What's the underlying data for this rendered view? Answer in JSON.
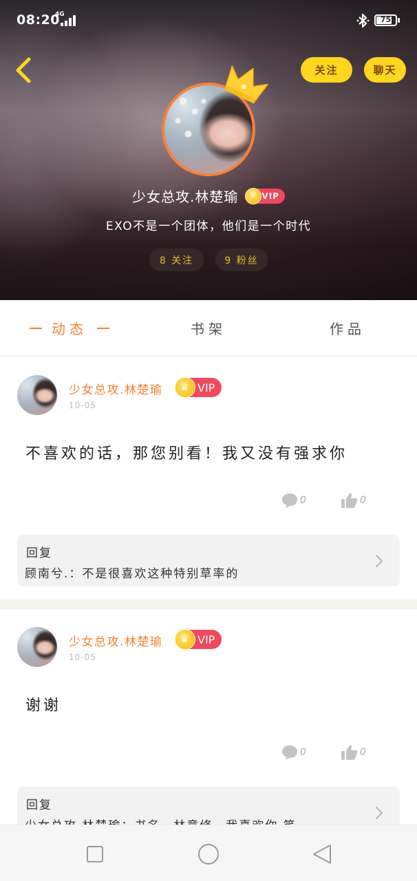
{
  "status_bar": {
    "time": "08:20",
    "network": "4G",
    "battery": "75"
  },
  "header": {
    "follow_label": "关注",
    "chat_label": "聊天",
    "username": "少女总攻.林楚瑜",
    "vip_label": "VIP",
    "bio": "EXO不是一个团体，他们是一个时代",
    "following": "8 关注",
    "fans": "9 粉丝"
  },
  "tabs": [
    {
      "label": "动态",
      "active": true
    },
    {
      "label": "书架",
      "active": false
    },
    {
      "label": "作品",
      "active": false
    }
  ],
  "posts": [
    {
      "author": "少女总攻.林楚瑜",
      "vip_label": "VIP",
      "date": "10-05",
      "content": "不喜欢的话，那您别看！我又没有强求你",
      "comments": "0",
      "likes": "0",
      "reply_label": "回复",
      "reply_text": "顾南兮.：不是很喜欢这种特别草率的"
    },
    {
      "author": "少女总攻.林楚瑜",
      "vip_label": "VIP",
      "date": "10-05",
      "content": "谢谢",
      "comments": "0",
      "likes": "0",
      "reply_label": "回复",
      "reply_text": "少女总攻.林楚瑜：书名，林意修，我喜欢你 笑..."
    }
  ],
  "colors": {
    "accent": "#f0822f",
    "button_yellow": "#ffd61f",
    "vip_red": "#f0485c"
  },
  "icons": [
    "back-arrow-icon",
    "crown-icon",
    "comment-icon",
    "thumbs-up-icon",
    "chevron-right-icon",
    "bluetooth-icon",
    "signal-icon",
    "battery-icon",
    "square-icon",
    "circle-icon",
    "triangle-back-icon"
  ]
}
